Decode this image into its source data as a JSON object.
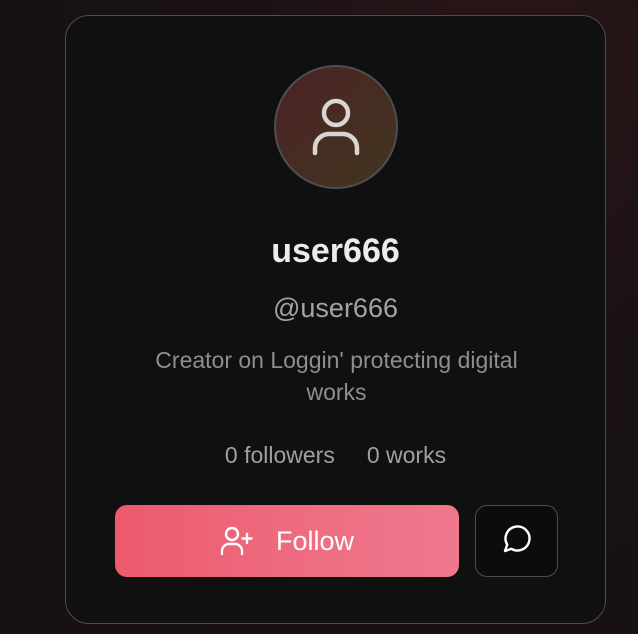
{
  "profile": {
    "display_name": "user666",
    "handle": "@user666",
    "bio": "Creator on Loggin' protecting digital works",
    "avatar_icon": "user-icon",
    "stats": {
      "followers": "0 followers",
      "works": "0 works"
    }
  },
  "actions": {
    "follow_label": "Follow",
    "follow_icon": "user-plus-icon",
    "message_icon": "message-circle-icon"
  },
  "colors": {
    "follow_gradient_start": "#ec5a6c",
    "follow_gradient_end": "#ef788d",
    "card_border": "#4a4d55",
    "card_background": "#111011"
  }
}
